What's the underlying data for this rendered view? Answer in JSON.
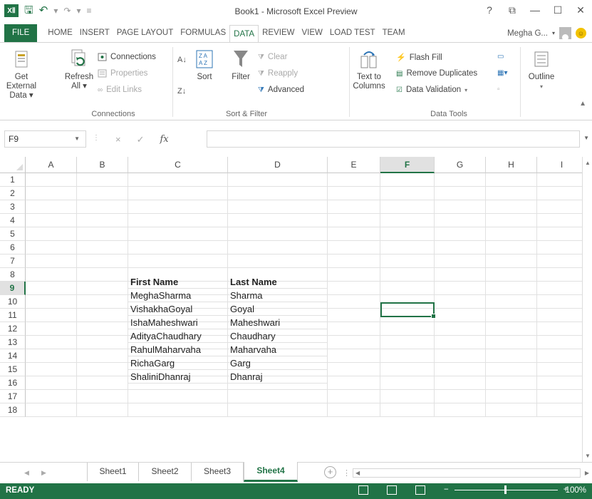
{
  "window": {
    "title": "Book1 - Microsoft Excel Preview",
    "controls": [
      "?",
      "⧉",
      "—",
      "☐",
      "✕"
    ]
  },
  "qat": {
    "logo": "XⅡ"
  },
  "tabs": [
    "FILE",
    "HOME",
    "INSERT",
    "PAGE LAYOUT",
    "FORMULAS",
    "DATA",
    "REVIEW",
    "VIEW",
    "LOAD TEST",
    "TEAM"
  ],
  "active_tab": "DATA",
  "account": {
    "user": "Megha G..."
  },
  "ribbon": {
    "get_external_data": [
      "Get External",
      "Data ▾"
    ],
    "refresh_all": [
      "Refresh",
      "All ▾"
    ],
    "connections": "Connections",
    "properties": "Properties",
    "edit_links": "Edit Links",
    "group_connections": "Connections",
    "sort": "Sort",
    "filter": "Filter",
    "clear": "Clear",
    "reapply": "Reapply",
    "advanced": "Advanced",
    "group_sort_filter": "Sort & Filter",
    "text_to_columns": [
      "Text to",
      "Columns"
    ],
    "flash_fill": "Flash Fill",
    "remove_duplicates": "Remove Duplicates",
    "data_validation": "Data Validation",
    "group_data_tools": "Data Tools",
    "outline": "Outline"
  },
  "formula_bar": {
    "name_box": "F9",
    "formula": "",
    "cancel": "×",
    "enter": "✓",
    "fx": "fx"
  },
  "columns": [
    "A",
    "B",
    "C",
    "D",
    "E",
    "F",
    "G",
    "H",
    "I"
  ],
  "selected_column": "F",
  "rows": [
    "1",
    "2",
    "3",
    "4",
    "5",
    "6",
    "7",
    "8",
    "9",
    "10",
    "11",
    "12",
    "13",
    "14",
    "15",
    "16",
    "17",
    "18"
  ],
  "selected_row": "9",
  "cells": {
    "headers": {
      "first": "First Name",
      "last": "Last Name"
    },
    "first_names": [
      "MeghaSharma",
      "VishakhaGoyal",
      "IshaMaheshwari",
      "AdityaChaudhary",
      "RahulMaharvaha",
      "RichaGarg",
      "ShaliniDhanraj"
    ],
    "last_names": [
      "Sharma",
      "Goyal",
      "Maheshwari",
      "Chaudhary",
      "Maharvaha",
      "Garg",
      "Dhanraj"
    ]
  },
  "sheets": [
    "Sheet1",
    "Sheet2",
    "Sheet3",
    "Sheet4"
  ],
  "active_sheet": "Sheet4",
  "status": {
    "mode": "READY",
    "zoom": "100%"
  },
  "colors": {
    "accent": "#217346",
    "status_bar": "#217346"
  }
}
